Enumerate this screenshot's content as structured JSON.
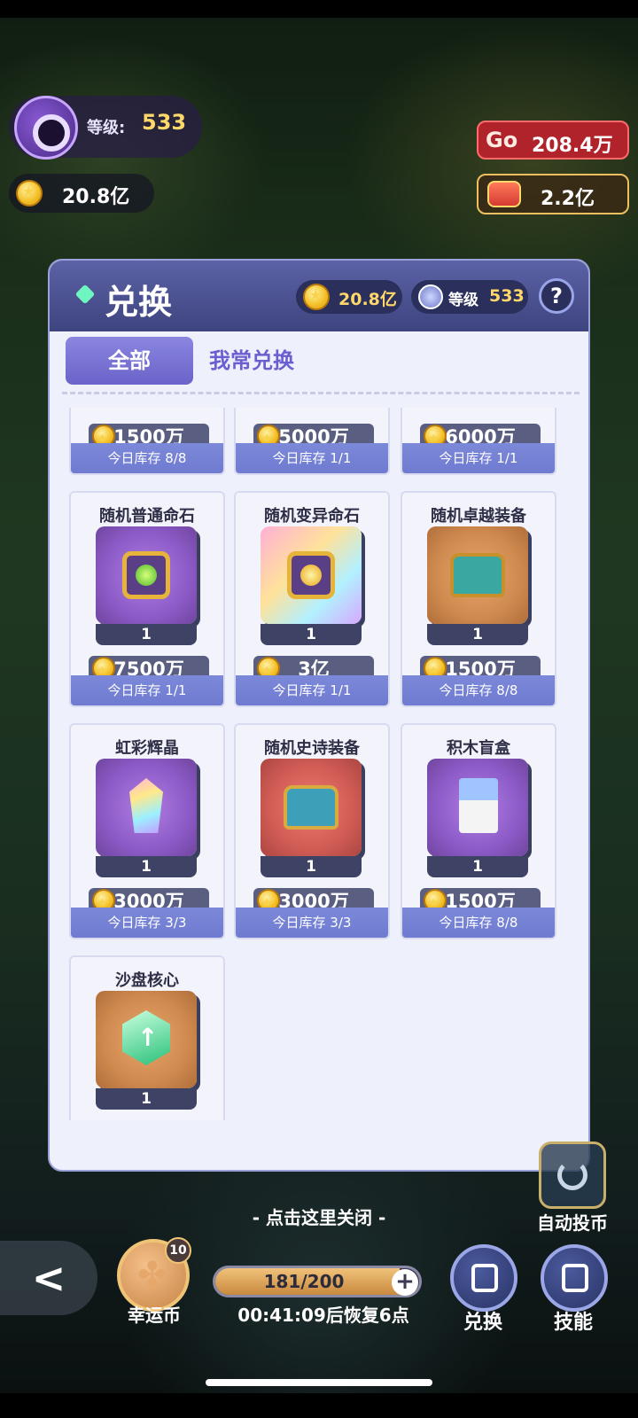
{
  "hud": {
    "level_label": "等级:",
    "level_value": "533",
    "coins": "20.8亿",
    "go_logo": "Go",
    "go_value": "208.4万",
    "gems": "2.2亿"
  },
  "modal": {
    "title": "兑换",
    "coins": "20.8亿",
    "level_label": "等级",
    "level_value": "533",
    "help": "?",
    "tabs": [
      {
        "label": "全部",
        "active": true
      },
      {
        "label": "我常兑换",
        "active": false
      }
    ],
    "partial_row": [
      {
        "price": "1500万",
        "stock": "今日库存 8/8"
      },
      {
        "price": "5000万",
        "stock": "今日库存 1/1"
      },
      {
        "price": "6000万",
        "stock": "今日库存 1/1"
      }
    ],
    "items": [
      {
        "name": "随机普通命石",
        "icon": "green-gem-box-icon",
        "qty": "1",
        "price": "7500万",
        "stock": "今日库存 1/1"
      },
      {
        "name": "随机变异命石",
        "icon": "yellow-gem-box-icon",
        "qty": "1",
        "price": "3亿",
        "stock": "今日库存 1/1"
      },
      {
        "name": "随机卓越装备",
        "icon": "treasure-chest-icon",
        "qty": "1",
        "price": "1500万",
        "stock": "今日库存 8/8"
      },
      {
        "name": "虹彩辉晶",
        "icon": "rainbow-crystal-icon",
        "qty": "1",
        "price": "3000万",
        "stock": "今日库存 3/3"
      },
      {
        "name": "随机史诗装备",
        "icon": "epic-chest-icon",
        "qty": "1",
        "price": "3000万",
        "stock": "今日库存 3/3"
      },
      {
        "name": "积木盲盒",
        "icon": "blind-box-icon",
        "qty": "1",
        "price": "1500万",
        "stock": "今日库存 8/8"
      },
      {
        "name": "沙盘核心",
        "icon": "sandbox-core-icon",
        "qty": "1"
      }
    ]
  },
  "bottom": {
    "close_hint": "- 点击这里关闭 -",
    "back": "<",
    "lucky_label": "幸运币",
    "lucky_count": "10",
    "energy_text": "181/200",
    "energy_fraction": 0.905,
    "plus": "+",
    "recover_text": "00:41:09后恢复6点",
    "exchange_label": "兑换",
    "skill_label": "技能",
    "auto_label": "自动投币"
  }
}
